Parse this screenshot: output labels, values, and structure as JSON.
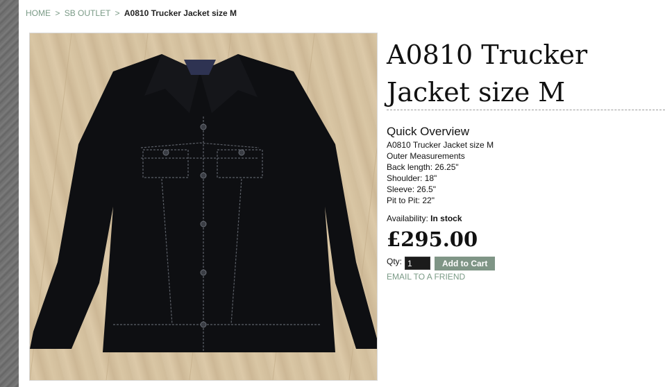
{
  "breadcrumb": {
    "home": "HOME",
    "separator": ">",
    "category": "SB OUTLET",
    "current": "A0810 Trucker Jacket size M"
  },
  "product": {
    "image_alt": "black suede trucker jacket on wooden floor",
    "title": "A0810 Trucker Jacket size M",
    "overview_heading": "Quick Overview",
    "description_lines": [
      "A0810 Trucker Jacket size M",
      "Outer Measurements",
      "Back length: 26.25\"",
      "Shoulder: 18\"",
      "Sleeve: 26.5\"",
      "Pit to Pit: 22\""
    ],
    "availability_label": "Availability:",
    "availability_value": "In stock",
    "price": "£295.00",
    "qty_label": "Qty:",
    "qty_value": "1",
    "add_to_cart_label": "Add to Cart",
    "email_friend_label": "EMAIL TO A FRIEND"
  },
  "colors": {
    "accent": "#7a9a86",
    "button": "#7f9586",
    "qty_bg": "#1b1b1b"
  }
}
